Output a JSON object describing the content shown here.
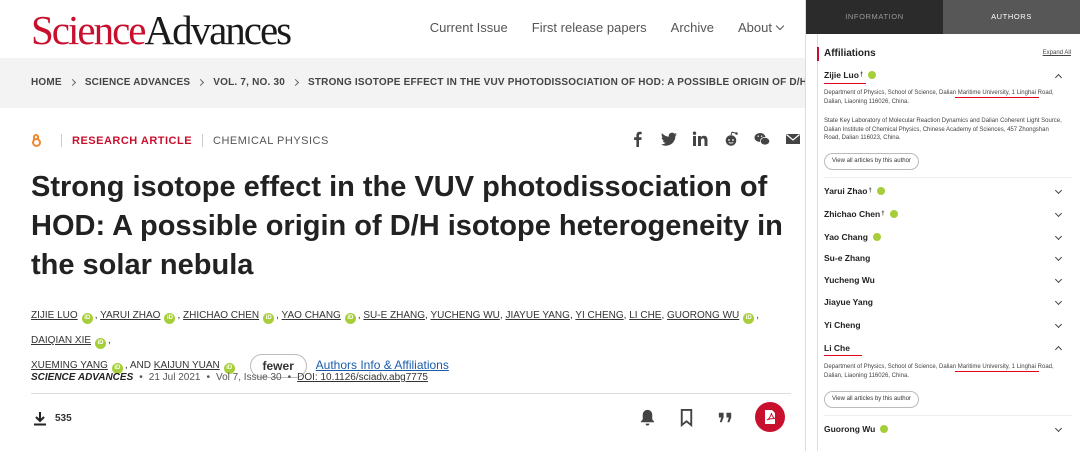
{
  "header": {
    "logo_part1": "Science",
    "logo_part2": "Advances",
    "nav": [
      "Current Issue",
      "First release papers",
      "Archive",
      "About"
    ]
  },
  "breadcrumb": [
    "HOME",
    "SCIENCE ADVANCES",
    "VOL. 7, NO. 30",
    "STRONG ISOTOPE EFFECT IN THE VUV PHOTODISSOCIATION OF HOD: A POSSIBLE ORIGIN OF D/H ISOTOPE..."
  ],
  "article": {
    "type": "RESEARCH ARTICLE",
    "category": "CHEMICAL PHYSICS",
    "title": "Strong isotope effect in the VUV photodissociation of HOD: A possible origin of D/H isotope heterogeneity in the solar nebula",
    "authors": [
      "ZIJIE LUO",
      "YARUI ZHAO",
      "ZHICHAO CHEN",
      "YAO CHANG",
      "SU-E ZHANG",
      "YUCHENG WU",
      "JIAYUE YANG",
      "YI CHENG",
      "LI CHE",
      "GUORONG WU",
      "DAIQIAN XIE",
      "XUEMING YANG",
      "KAIJUN YUAN"
    ],
    "and_text": ", AND",
    "fewer_label": "fewer",
    "authors_info_link": "Authors Info & Affiliations",
    "journal": "SCIENCE ADVANCES",
    "date": "21 Jul 2021",
    "volume": "Vol 7, Issue 30",
    "doi": "DOI: 10.1126/sciadv.abg7775",
    "downloads": "535"
  },
  "sidebar": {
    "tab_information": "INFORMATION",
    "tab_authors": "AUTHORS",
    "affiliations_heading": "Affiliations",
    "expand_all": "Expand All",
    "view_all_label": "View all articles by this author",
    "authors": [
      {
        "name": "Zijie Luo",
        "dagger": "†",
        "orcid": true,
        "expanded": true
      },
      {
        "name": "Yarui Zhao",
        "dagger": "†",
        "orcid": true,
        "expanded": false
      },
      {
        "name": "Zhichao Chen",
        "dagger": "†",
        "orcid": true,
        "expanded": false
      },
      {
        "name": "Yao Chang",
        "dagger": "",
        "orcid": true,
        "expanded": false
      },
      {
        "name": "Su-e Zhang",
        "dagger": "",
        "orcid": false,
        "expanded": false
      },
      {
        "name": "Yucheng Wu",
        "dagger": "",
        "orcid": false,
        "expanded": false
      },
      {
        "name": "Jiayue Yang",
        "dagger": "",
        "orcid": false,
        "expanded": false
      },
      {
        "name": "Yi Cheng",
        "dagger": "",
        "orcid": false,
        "expanded": false
      },
      {
        "name": "Li Che",
        "dagger": "",
        "orcid": false,
        "expanded": true
      },
      {
        "name": "Guorong Wu",
        "dagger": "",
        "orcid": true,
        "expanded": false
      }
    ],
    "affil_dmu": "Department of Physics, School of Science, Dalian Maritime University, 1 Linghai Road, Dalian, Liaoning 116026, China.",
    "affil_skl": "State Key Laboratory of Molecular Reaction Dynamics and Dalian Coherent Light Source, Dalian Institute of Chemical Physics, Chinese Academy of Sciences, 457 Zhongshan Road, Dalian 116023, China."
  }
}
